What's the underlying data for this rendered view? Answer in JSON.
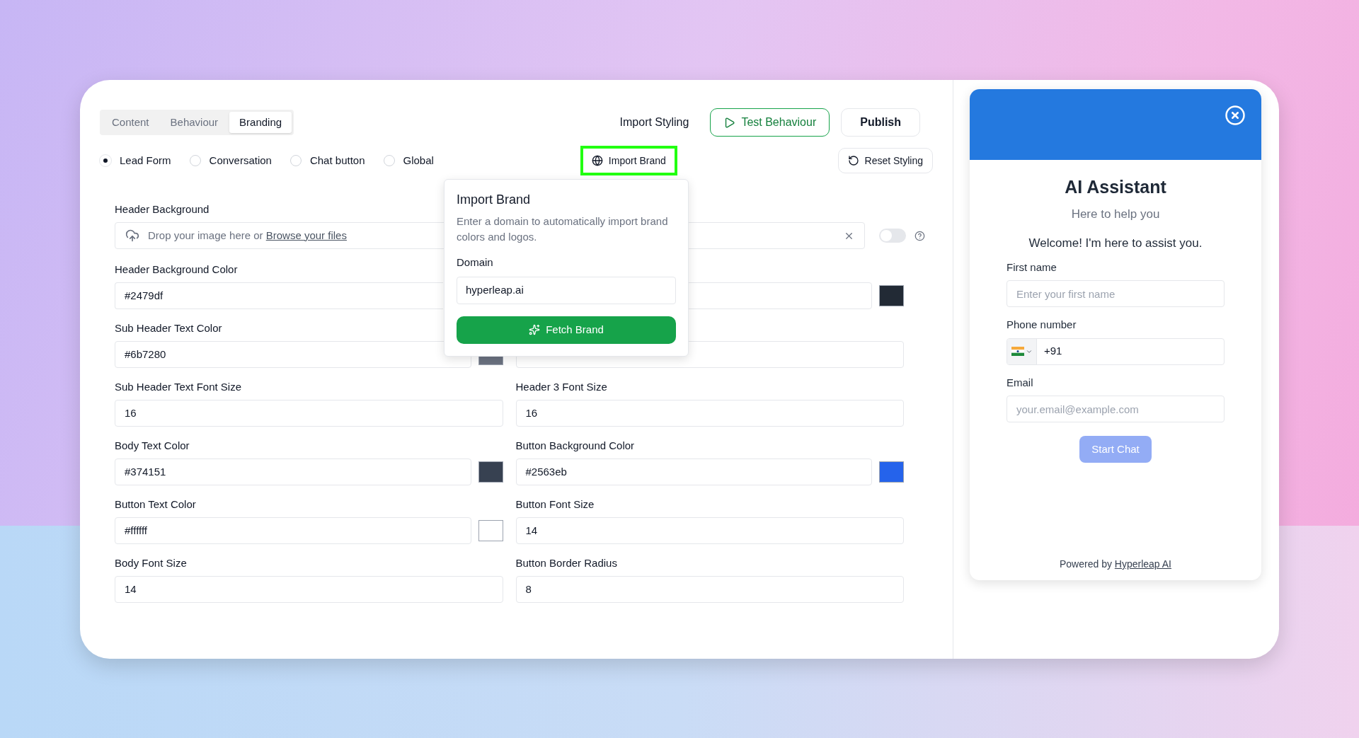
{
  "tabs": [
    {
      "label": "Content",
      "selected": false
    },
    {
      "label": "Behaviour",
      "selected": false
    },
    {
      "label": "Branding",
      "selected": true
    }
  ],
  "actions": {
    "import_styling": "Import Styling",
    "test_behaviour": "Test Behaviour",
    "publish": "Publish"
  },
  "sections": [
    {
      "label": "Lead Form",
      "selected": true
    },
    {
      "label": "Conversation",
      "selected": false
    },
    {
      "label": "Chat button",
      "selected": false
    },
    {
      "label": "Global",
      "selected": false
    }
  ],
  "import_brand_button": "Import Brand",
  "reset_button": "Reset Styling",
  "header_background": {
    "label": "Header Background",
    "drop_text": "Drop your image here or",
    "browse_link": "Browse your files",
    "on": false
  },
  "fields": [
    {
      "kind": "color",
      "label": "Header Background Color",
      "value": "#2479df"
    },
    {
      "kind": "color",
      "color": "#222a35"
    },
    {
      "kind": "color",
      "label": "Sub Header Text Color",
      "value": "#6b7280",
      "color": "#6b7280"
    },
    {
      "kind": "text"
    },
    {
      "kind": "text",
      "label": "Sub Header Text Font Size",
      "value": "16"
    },
    {
      "kind": "text",
      "label": "Header 3 Font Size",
      "value": "16"
    },
    {
      "kind": "color",
      "label": "Body Text Color",
      "value": "#374151",
      "color": "#374151"
    },
    {
      "kind": "color",
      "label": "Button Background Color",
      "value": "#2563eb",
      "color": "#2563eb"
    },
    {
      "kind": "color",
      "label": "Button Text Color",
      "value": "#ffffff",
      "color": "#ffffff"
    },
    {
      "kind": "text",
      "label": "Button Font Size",
      "value": "14"
    },
    {
      "kind": "text",
      "label": "Body Font Size",
      "value": "14"
    },
    {
      "kind": "text",
      "label": "Button Border Radius",
      "value": "8"
    }
  ],
  "popover": {
    "title": "Import Brand",
    "description": "Enter a domain to automatically import brand colors and logos.",
    "domain_label": "Domain",
    "domain_value": "hyperleap.ai",
    "button": "Fetch Brand"
  },
  "preview": {
    "title": "AI Assistant",
    "subtitle": "Here to help you",
    "welcome": "Welcome! I'm here to assist you.",
    "fields": [
      {
        "kind": "text",
        "label": "First name",
        "placeholder": "Enter your first name"
      },
      {
        "kind": "phone",
        "label": "Phone number",
        "value": "+91"
      },
      {
        "kind": "text",
        "label": "Email",
        "placeholder": "your.email@example.com"
      }
    ],
    "button": "Start Chat",
    "powered_by": "Powered by",
    "link": "Hyperleap AI"
  }
}
